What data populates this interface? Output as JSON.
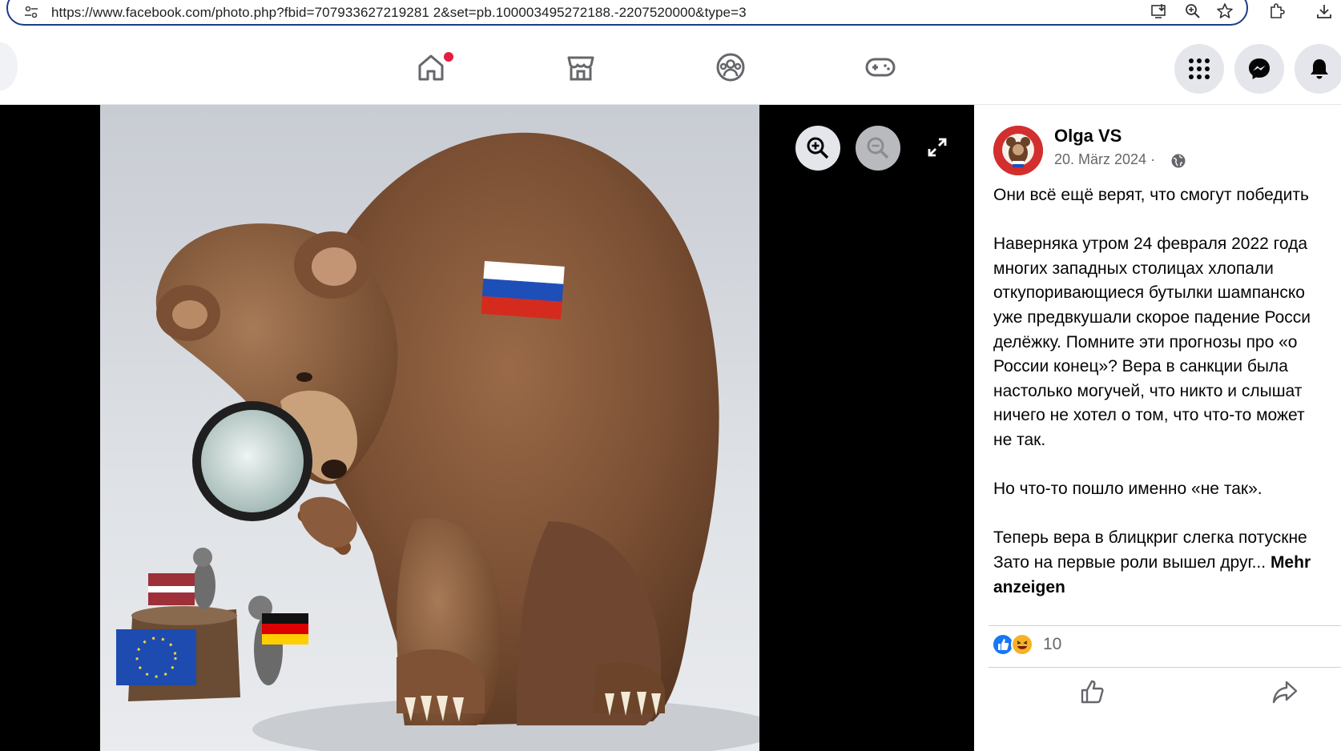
{
  "browser": {
    "url": "https://www.facebook.com/photo.php?fbid=707933627219281 2&set=pb.100003495272188.-2207520000&type=3",
    "icons": [
      "tune-icon",
      "install-icon",
      "zoom-icon",
      "star-icon",
      "extensions-icon",
      "download-icon"
    ]
  },
  "nav": {
    "center_icons": [
      "home-icon",
      "marketplace-icon",
      "groups-icon",
      "gaming-icon"
    ],
    "right_icons": [
      "menu-grid-icon",
      "messenger-icon",
      "notifications-icon"
    ],
    "home_has_notification": true
  },
  "viewer": {
    "controls": [
      "zoom-in-icon",
      "zoom-out-icon",
      "fullscreen-icon"
    ]
  },
  "post": {
    "author": "Olga VS",
    "date": "20. März 2024 ·",
    "audience_icon": "globe-icon",
    "lines": [
      "Они всё ещё верят, что смогут победить",
      "",
      "Наверняка утром 24 февраля 2022 года",
      "многих западных столицах хлопали",
      "откупоривающиеся бутылки шампанско",
      "уже предвкушали скорое падение Росси",
      "делёжку. Помните эти прогнозы про «о",
      "России конец»? Вера в санкции была",
      "настолько могучей, что никто и слышат",
      "ничего не хотел о том, что что-то может",
      "не так.",
      "",
      "Но что-то пошло именно «не так».",
      "",
      "Теперь вера в блицкриг слегка потускне"
    ],
    "last_line": "Зато на первые роли вышел друг...",
    "more_label_1": "Mehr",
    "more_label_2": "anzeigen",
    "reaction_count": "10",
    "reaction_icons": [
      "like-reaction-icon",
      "haha-reaction-icon"
    ],
    "actions": [
      "like-icon",
      "share-icon"
    ]
  }
}
